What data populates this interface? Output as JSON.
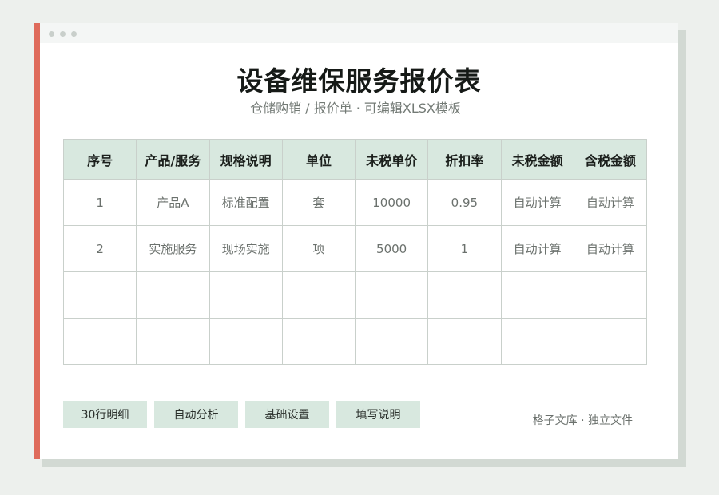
{
  "document": {
    "title": "设备维保服务报价表",
    "subtitle": "仓储购销 / 报价单 · 可编辑XLSX模板"
  },
  "table": {
    "headers": [
      "序号",
      "产品/服务",
      "规格说明",
      "单位",
      "未税单价",
      "折扣率",
      "未税金额",
      "含税金额"
    ],
    "rows": [
      [
        "1",
        "产品A",
        "标准配置",
        "套",
        "10000",
        "0.95",
        "自动计算",
        "自动计算"
      ],
      [
        "2",
        "实施服务",
        "现场实施",
        "项",
        "5000",
        "1",
        "自动计算",
        "自动计算"
      ],
      [
        "",
        "",
        "",
        "",
        "",
        "",
        "",
        ""
      ],
      [
        "",
        "",
        "",
        "",
        "",
        "",
        "",
        ""
      ]
    ]
  },
  "buttons": {
    "rows_detail": "30行明细",
    "auto_analysis": "自动分析",
    "base_settings": "基础设置",
    "fill_instructions": "填写说明"
  },
  "footer": {
    "note": "格子文库 · 独立文件"
  },
  "colors": {
    "accent": "#df6b5b",
    "header_bg": "#d8e8df",
    "page_bg": "#edf0ed"
  }
}
